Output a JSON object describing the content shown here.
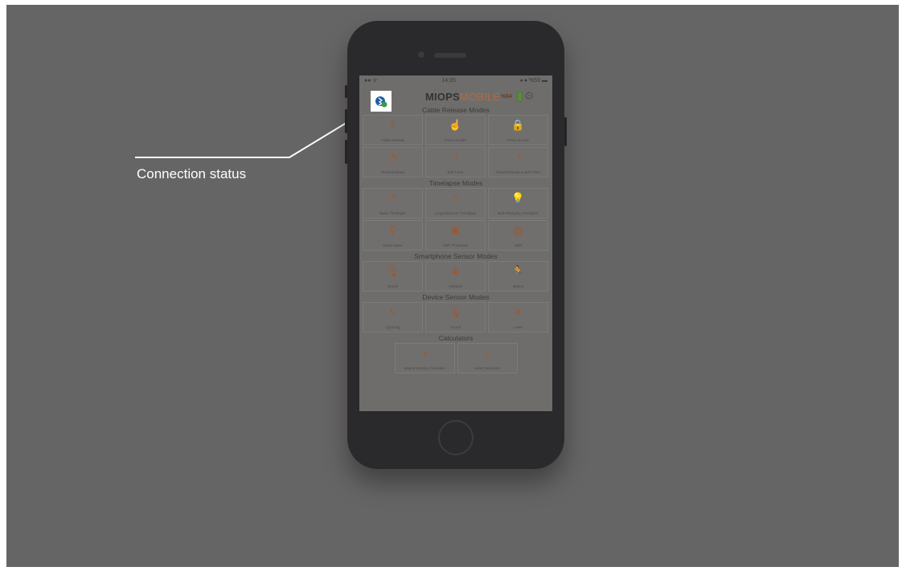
{
  "annotation": {
    "label": "Connection status"
  },
  "status_bar": {
    "left": "●● ᯤ",
    "time": "14:35",
    "right": "◂ ● %53 ▬"
  },
  "header": {
    "brand_part1": "MIOPS",
    "brand_part2": "MOBILE",
    "device_battery": "%64"
  },
  "sections": [
    {
      "title": "Cable Release Modes",
      "tiles": [
        {
          "label": "Cable Release",
          "icon": "cable-icon",
          "glyph": "⥮"
        },
        {
          "label": "Press & Hold",
          "icon": "hand-icon",
          "glyph": "☝"
        },
        {
          "label": "Press & Lock",
          "icon": "lock-icon",
          "glyph": "🔒"
        },
        {
          "label": "Timed Release",
          "icon": "clock-icon",
          "glyph": "◷"
        },
        {
          "label": "Self Timer",
          "icon": "pie-timer-icon",
          "glyph": "◔"
        },
        {
          "label": "Timed Release & Self Timer",
          "icon": "pie-timer-icon",
          "glyph": "◔"
        }
      ]
    },
    {
      "title": "Timelapse Modes",
      "tiles": [
        {
          "label": "Basic Timelapse",
          "icon": "stopwatch-icon",
          "glyph": "⏱"
        },
        {
          "label": "Long Exposure Timelapse",
          "icon": "stopwatch-icon",
          "glyph": "⏱"
        },
        {
          "label": "Bulb Ramping Timelapse",
          "icon": "bulb-icon",
          "glyph": "💡"
        },
        {
          "label": "Road Lapse",
          "icon": "road-pin-icon",
          "glyph": "⚲"
        },
        {
          "label": "HDR Timelapse",
          "icon": "hdr-camera-icon",
          "glyph": "▣"
        },
        {
          "label": "HDR",
          "icon": "image-icon",
          "glyph": "▨"
        }
      ]
    },
    {
      "title": "Smartphone Sensor Modes",
      "tiles": [
        {
          "label": "Sound",
          "icon": "microphone-icon",
          "glyph": "🎙"
        },
        {
          "label": "Vibration",
          "icon": "vibration-icon",
          "glyph": "◈"
        },
        {
          "label": "Motion",
          "icon": "running-icon",
          "glyph": "🏃"
        }
      ]
    },
    {
      "title": "Device Sensor Modes",
      "tiles": [
        {
          "label": "Lightning",
          "icon": "lightning-icon",
          "glyph": "ϟ"
        },
        {
          "label": "Sound",
          "icon": "microphone-icon",
          "glyph": "🎙"
        },
        {
          "label": "Laser",
          "icon": "laser-icon",
          "glyph": "✳"
        }
      ]
    },
    {
      "title": "Calculators",
      "tiles": [
        {
          "label": "Neutral Density Calculator",
          "icon": "contrast-icon",
          "glyph": "◑"
        },
        {
          "label": "Solar Calculator",
          "icon": "sun-icon",
          "glyph": "☼"
        }
      ]
    }
  ],
  "colors": {
    "accent": "#b66a39",
    "background": "#666565",
    "connection_icon": "#1f5fa8"
  }
}
